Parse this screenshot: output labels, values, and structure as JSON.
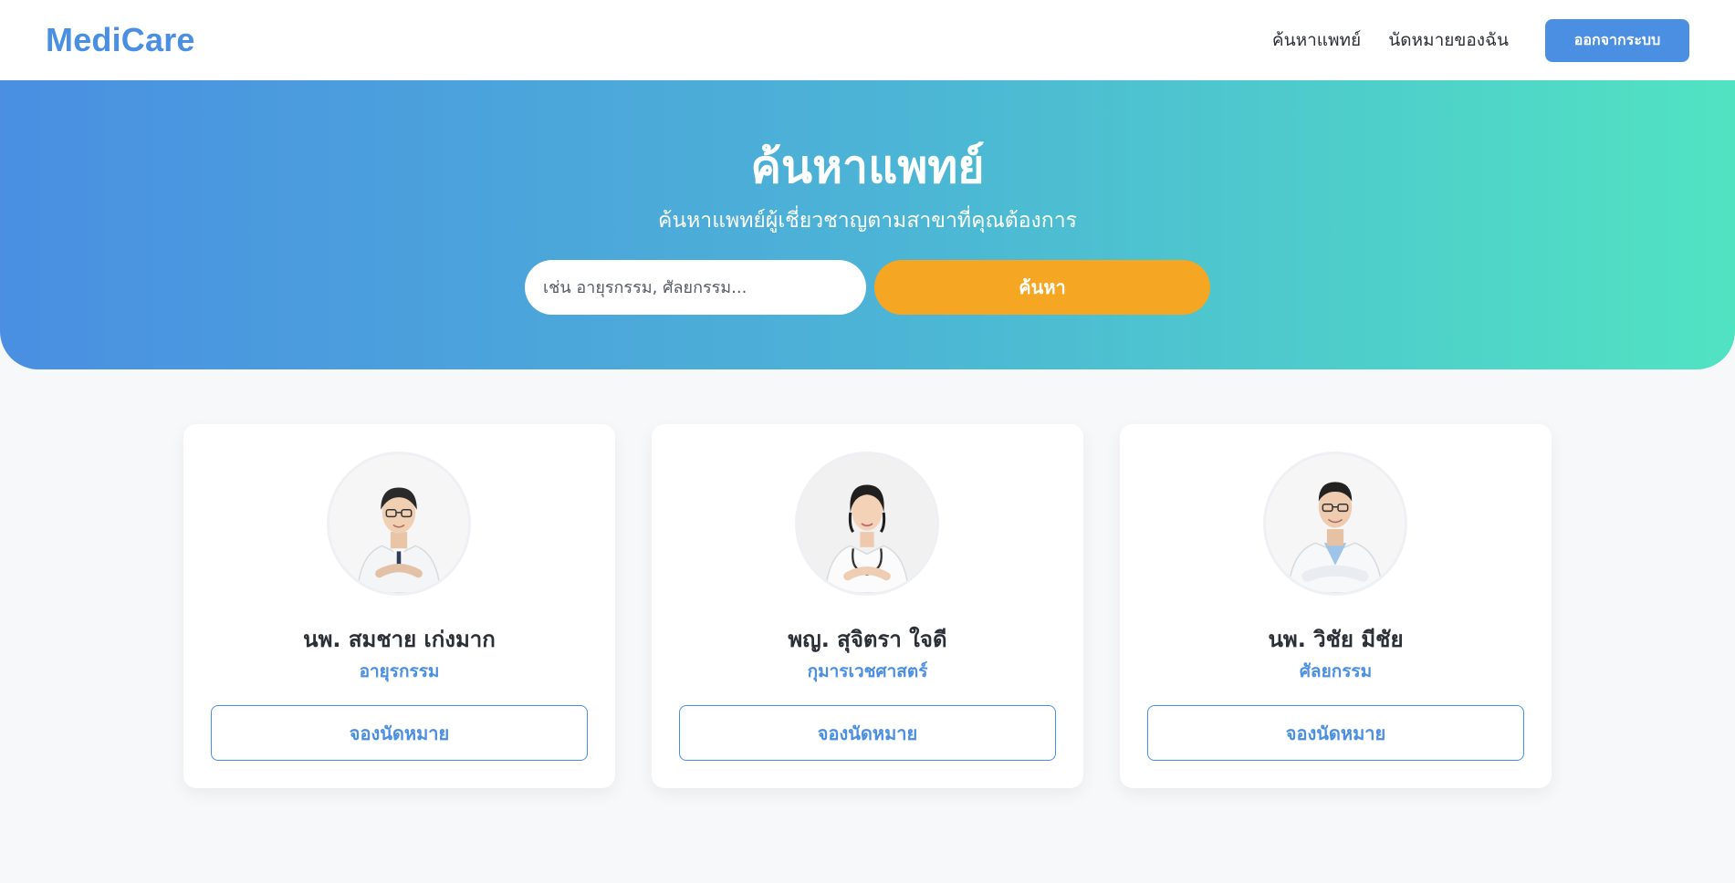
{
  "header": {
    "logo": "MediCare",
    "nav": [
      {
        "label": "ค้นหาแพทย์"
      },
      {
        "label": "นัดหมายของฉัน"
      }
    ],
    "logout_label": "ออกจากระบบ"
  },
  "hero": {
    "title": "ค้นหาแพทย์",
    "subtitle": "ค้นหาแพทย์ผู้เชี่ยวชาญตามสาขาที่คุณต้องการ",
    "search_placeholder": "เช่น อายุรกรรม, ศัลยกรรม...",
    "search_value": "",
    "search_button": "ค้นหา"
  },
  "doctors": [
    {
      "name": "นพ. สมชาย เก่งมาก",
      "specialty": "อายุรกรรม",
      "book_label": "จองนัดหมาย",
      "avatar_icon": "doctor-male-photo"
    },
    {
      "name": "พญ. สุจิตรา ใจดี",
      "specialty": "กุมารเวชศาสตร์",
      "book_label": "จองนัดหมาย",
      "avatar_icon": "doctor-female-photo"
    },
    {
      "name": "นพ. วิชัย มีชัย",
      "specialty": "ศัลยกรรม",
      "book_label": "จองนัดหมาย",
      "avatar_icon": "doctor-male-photo"
    }
  ],
  "colors": {
    "brand": "#4a8fe2",
    "accent": "#f5a623",
    "gradient_start": "#4a8fe2",
    "gradient_end": "#50e3c2"
  }
}
